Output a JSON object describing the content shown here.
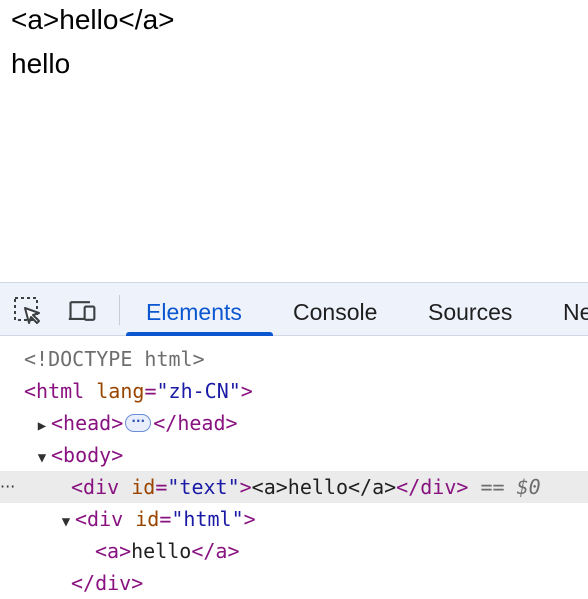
{
  "page": {
    "line1": "<a>hello</a>",
    "line2": "hello"
  },
  "devtools": {
    "toolbar": {
      "inspect_icon": "inspect-element-icon",
      "device_icon": "device-toolbar-icon"
    },
    "tabs": [
      {
        "label": "Elements",
        "active": true
      },
      {
        "label": "Console",
        "active": false
      },
      {
        "label": "Sources",
        "active": false
      },
      {
        "label": "Ne",
        "active": false
      }
    ],
    "accent_color": "#0b57d0",
    "dom": {
      "doctype": "<!DOCTYPE html>",
      "html_open": {
        "tag_open": "<html",
        "attr_name": "lang",
        "eq": "=",
        "attr_value": "\"zh-CN\"",
        "tag_close": ">"
      },
      "head_line": {
        "open": "<head>",
        "badge": "···",
        "close": "</head>"
      },
      "body_open": "<body>",
      "div_text": {
        "tag_open": "<div",
        "attr_name": "id",
        "eq": "=",
        "attr_value": "\"text\"",
        "tag_close": ">",
        "content": "<a>hello</a>",
        "close": "</div>",
        "ref": "== $0",
        "gutter": "···"
      },
      "div_html": {
        "tag_open": "<div",
        "attr_name": "id",
        "eq": "=",
        "attr_value": "\"html\"",
        "tag_close": ">"
      },
      "a_line": {
        "open": "<a>",
        "text": "hello",
        "close": "</a>"
      },
      "div_close": "</div>"
    }
  }
}
